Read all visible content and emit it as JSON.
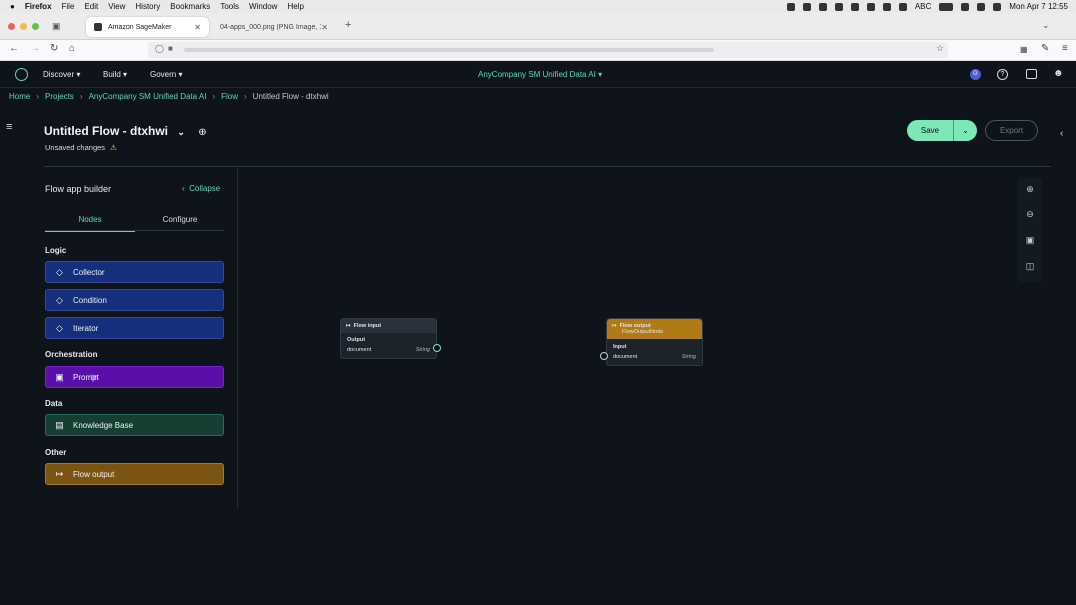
{
  "os_menubar": {
    "app": "Firefox",
    "menus": [
      "File",
      "Edit",
      "View",
      "History",
      "Bookmarks",
      "Tools",
      "Window",
      "Help"
    ],
    "input_label": "ABC",
    "clock": "Mon Apr 7  12:55"
  },
  "browser": {
    "tabs": [
      {
        "title": "Amazon SageMaker",
        "active": true
      },
      {
        "title": "04-apps_000.png (PNG Image, 163…",
        "active": false
      }
    ]
  },
  "app_header": {
    "nav": [
      "Discover",
      "Build",
      "Govern"
    ],
    "domain": "AnyCompany SM Unified Data AI",
    "avatar_letter": "G"
  },
  "breadcrumb": [
    "Home",
    "Projects",
    "AnyCompany SM Unified Data AI",
    "Flow",
    "Untitled Flow - dtxhwi"
  ],
  "flow": {
    "title": "Untitled Flow - dtxhwi",
    "status": "Unsaved changes",
    "save_label": "Save",
    "export_label": "Export"
  },
  "builder": {
    "title": "Flow app builder",
    "collapse_label": "Collapse",
    "tabs": [
      "Nodes",
      "Configure"
    ],
    "sections": [
      {
        "label": "Logic",
        "items": [
          "Collector",
          "Condition",
          "Iterator"
        ]
      },
      {
        "label": "Orchestration",
        "items": [
          "Prompt"
        ]
      },
      {
        "label": "Data",
        "items": [
          "Knowledge Base"
        ]
      },
      {
        "label": "Other",
        "items": [
          "Flow output"
        ]
      }
    ]
  },
  "canvas": {
    "input_node": {
      "title": "Flow input",
      "section": "Output",
      "field": "document",
      "type": "String"
    },
    "output_node": {
      "title": "Flow output",
      "subtitle": "FlowOutputNode",
      "section": "Input",
      "field": "document",
      "type": "String"
    }
  },
  "colors": {
    "accent": "#58d6c4",
    "save": "#7ce8b8",
    "logic": "#162f7c",
    "orchestration": "#5a0fa8",
    "data": "#163f34",
    "other": "#7a5410"
  }
}
